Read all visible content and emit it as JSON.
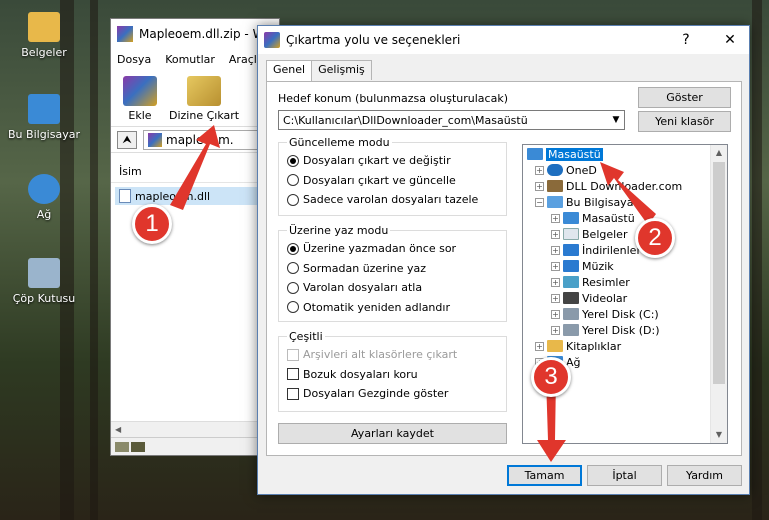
{
  "desktop": {
    "icons": [
      {
        "label": "Belgeler",
        "icon": "folder-documents-icon",
        "color": "#e8b84a"
      },
      {
        "label": "Bu Bilgisayar",
        "icon": "computer-icon",
        "color": "#3a8ad6"
      },
      {
        "label": "Ağ",
        "icon": "network-icon",
        "color": "#3a8ad6"
      },
      {
        "label": "Çöp Kutusu",
        "icon": "recycle-bin-icon",
        "color": "#9ab4cc"
      }
    ]
  },
  "winrar": {
    "title": "Mapleoem.dll.zip - W",
    "menu": [
      "Dosya",
      "Komutlar",
      "Araçla"
    ],
    "toolbar": {
      "add_label": "Ekle",
      "extract_label": "Dizine Çıkart"
    },
    "path": "mapleoem.",
    "column_name": "İsim",
    "file": "mapleoem.dll"
  },
  "dialog": {
    "title": "Çıkartma yolu ve seçenekleri",
    "help_symbol": "?",
    "close_symbol": "✕",
    "tabs": [
      "Genel",
      "Gelişmiş"
    ],
    "destination_label": "Hedef konum (bulunmazsa oluşturulacak)",
    "destination_value": "C:\\Kullanıcılar\\DllDownloader_com\\Masaüstü",
    "show_button": "Göster",
    "new_folder_button": "Yeni klasör",
    "update_mode": {
      "title": "Güncelleme modu",
      "options": [
        "Dosyaları çıkart ve değiştir",
        "Dosyaları çıkart ve güncelle",
        "Sadece varolan dosyaları tazele"
      ],
      "selected": 0
    },
    "overwrite_mode": {
      "title": "Üzerine yaz modu",
      "options": [
        "Üzerine yazmadan önce sor",
        "Sormadan üzerine yaz",
        "Varolan dosyaları atla",
        "Otomatik yeniden adlandır"
      ],
      "selected": 0
    },
    "misc": {
      "title": "Çeşitli",
      "options": [
        "Arşivleri alt klasörlere çıkart",
        "Bozuk dosyaları koru",
        "Dosyaları Gezginde göster"
      ]
    },
    "save_settings_button": "Ayarları kaydet",
    "tree": [
      {
        "label": "Masaüstü",
        "selected": true
      },
      {
        "label": "OneD"
      },
      {
        "label": "DLL Downloader.com"
      },
      {
        "label": "Bu Bilgisaya"
      },
      {
        "label": "Masaüstü"
      },
      {
        "label": "Belgeler"
      },
      {
        "label": "İndirilenler"
      },
      {
        "label": "Müzik"
      },
      {
        "label": "Resimler"
      },
      {
        "label": "Videolar"
      },
      {
        "label": "Yerel Disk (C:)"
      },
      {
        "label": "Yerel Disk (D:)"
      },
      {
        "label": "Kitaplıklar"
      },
      {
        "label": "Ağ"
      }
    ],
    "ok_button": "Tamam",
    "cancel_button": "İptal",
    "help_button": "Yardım"
  },
  "markers": [
    "1",
    "2",
    "3"
  ],
  "colors": {
    "marker": "#e0362c",
    "selection": "#0078d7"
  }
}
